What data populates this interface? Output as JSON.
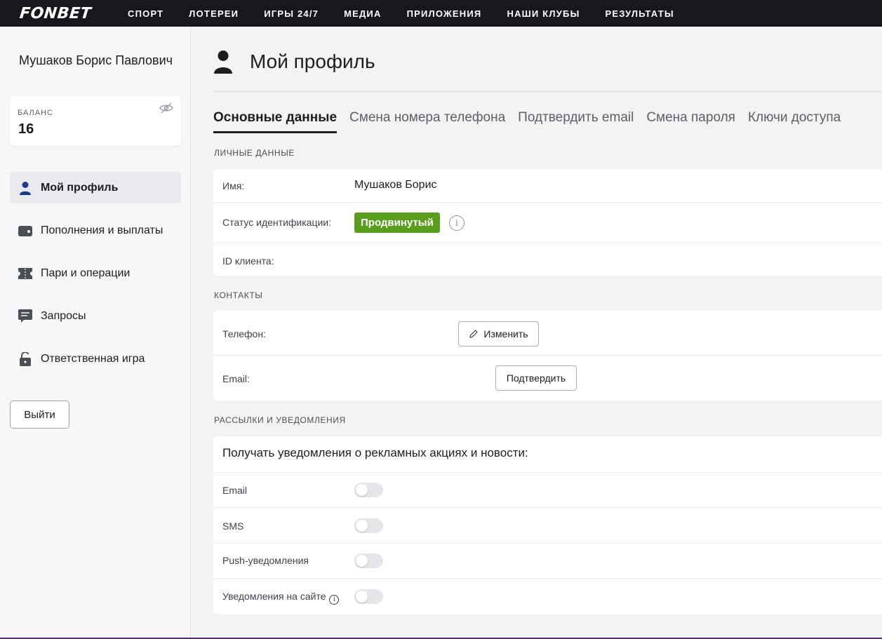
{
  "topbar": {
    "logo": "FONBET",
    "nav": [
      "СПОРТ",
      "ЛОТЕРЕИ",
      "ИГРЫ 24/7",
      "МЕДИА",
      "ПРИЛОЖЕНИЯ",
      "НАШИ КЛУБЫ",
      "РЕЗУЛЬТАТЫ"
    ]
  },
  "sidebar": {
    "user_name": "Мушаков Борис Павлович",
    "balance_label": "БАЛАНС",
    "balance_value": "16",
    "menu": [
      {
        "label": "Мой профиль",
        "icon": "user-icon",
        "active": true
      },
      {
        "label": "Пополнения и выплаты",
        "icon": "wallet-icon",
        "active": false
      },
      {
        "label": "Пари и операции",
        "icon": "ticket-icon",
        "active": false
      },
      {
        "label": "Запросы",
        "icon": "chat-icon",
        "active": false
      },
      {
        "label": "Ответственная игра",
        "icon": "lock-icon",
        "active": false
      }
    ],
    "logout_label": "Выйти"
  },
  "main": {
    "title": "Мой профиль",
    "tabs": [
      "Основные данные",
      "Смена номера телефона",
      "Подтвердить email",
      "Смена пароля",
      "Ключи доступа"
    ],
    "personal": {
      "section_title": "ЛИЧНЫЕ ДАННЫЕ",
      "name_label": "Имя:",
      "name_value": "Мушаков Борис",
      "status_label": "Статус идентификации:",
      "status_value": "Продвинутый",
      "id_label": "ID клиента:"
    },
    "contacts": {
      "section_title": "КОНТАКТЫ",
      "phone_label": "Телефон:",
      "change_button": "Изменить",
      "email_label": "Email:",
      "confirm_button": "Подтвердить"
    },
    "notifications": {
      "section_title": "РАССЫЛКИ И УВЕДОМЛЕНИЯ",
      "heading": "Получать уведомления о рекламных акциях и новости:",
      "items": [
        {
          "label": "Email",
          "enabled": false
        },
        {
          "label": "SMS",
          "enabled": false
        },
        {
          "label": "Push-уведомления",
          "enabled": false
        },
        {
          "label": "Уведомления на сайте",
          "enabled": false
        }
      ]
    }
  },
  "colors": {
    "topbar": "#16181d",
    "badge_green": "#5a9e1e",
    "accent_blue": "#1f3a8a",
    "icon_gray": "#4a4e55"
  }
}
